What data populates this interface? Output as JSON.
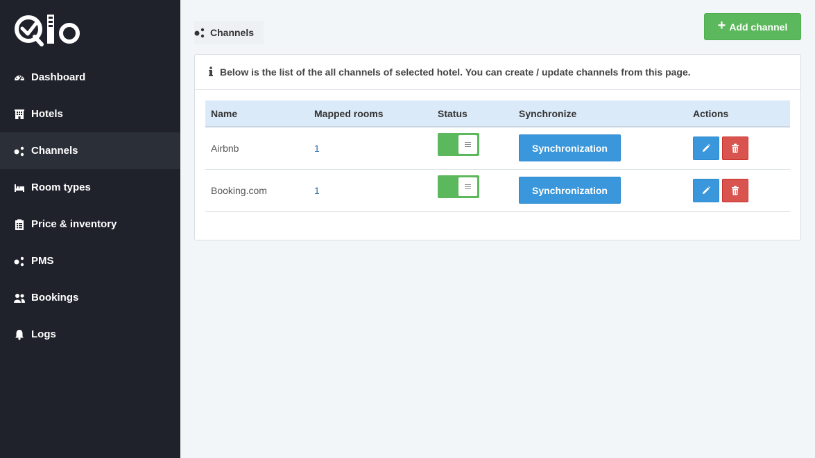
{
  "brand": {
    "logo_text": "Qio",
    "logo_icon": "qio-logo"
  },
  "sidebar": {
    "items": [
      {
        "label": "Dashboard",
        "icon": "dashboard-icon"
      },
      {
        "label": "Hotels",
        "icon": "hotel-icon"
      },
      {
        "label": "Channels",
        "icon": "channels-icon",
        "active": true
      },
      {
        "label": "Room types",
        "icon": "bed-icon"
      },
      {
        "label": "Price & inventory",
        "icon": "clipboard-icon"
      },
      {
        "label": "PMS",
        "icon": "pms-icon"
      },
      {
        "label": "Bookings",
        "icon": "users-icon"
      },
      {
        "label": "Logs",
        "icon": "bell-icon"
      }
    ]
  },
  "header": {
    "title": "Channels",
    "add_button_label": "Add channel"
  },
  "panel": {
    "info_text": "Below is the list of the all channels of selected hotel. You can create / update channels from this page.",
    "table": {
      "columns": [
        "Name",
        "Mapped rooms",
        "Status",
        "Synchronize",
        "Actions"
      ],
      "rows": [
        {
          "name": "Airbnb",
          "mapped_rooms": "1",
          "status": "on",
          "sync_label": "Synchronization"
        },
        {
          "name": "Booking.com",
          "mapped_rooms": "1",
          "status": "on",
          "sync_label": "Synchronization"
        }
      ]
    }
  },
  "colors": {
    "sidebar_bg": "#1f222b",
    "sidebar_active": "#2b2f38",
    "add_button": "#5cb85c",
    "toggle_on": "#5cb85c",
    "sync_button": "#3a97db",
    "edit_button": "#3a97db",
    "delete_button": "#d9534f",
    "table_header": "#dbeaf8"
  }
}
